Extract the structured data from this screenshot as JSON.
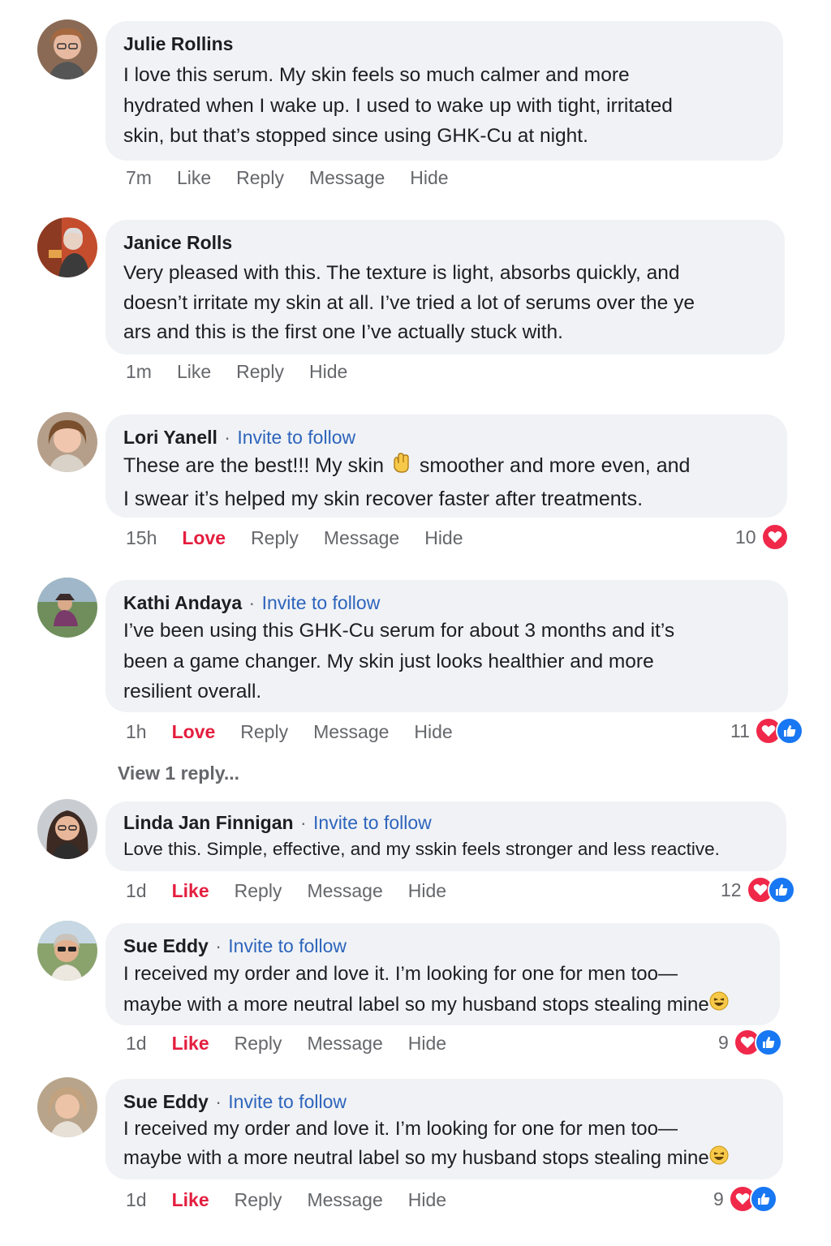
{
  "comments": [
    {
      "name": "Julie Rollins",
      "follow": "",
      "lines": [
        "I love this serum. My skin feels so much calmer and more",
        "hydrated when I wake up. I used to wake up with tight, irritated",
        "skin, but that’s stopped since using GHK-Cu at night."
      ],
      "time": "7m",
      "like": "Like",
      "reply": "Reply",
      "message": "Message",
      "hide": "Hide",
      "count": ""
    },
    {
      "name": "Janice Rolls",
      "follow": "",
      "lines": [
        "Very pleased with this. The texture is light, absorbs quickly, and",
        "doesn’t irritate my skin at all. I’ve tried a lot of serums over the ye",
        "ars and this is the first one I’ve actually stuck with."
      ],
      "time": "1m",
      "like": "Like",
      "reply": "Reply",
      "message": "",
      "hide": "Hide",
      "count": ""
    },
    {
      "name": "Lori Yanell",
      "follow": "Invite to follow",
      "line1a": "These are the best!!!  My skin ",
      "line1b": " smoother and more even, and",
      "line2": "I swear it’s helped my skin recover faster after treatments.",
      "time": "15h",
      "like": "Love",
      "reply": "Reply",
      "message": "Message",
      "hide": "Hide",
      "count": "10"
    },
    {
      "name": "Kathi Andaya",
      "follow": "Invite to follow",
      "lines": [
        "I’ve been using this GHK-Cu serum for about 3 months and it’s",
        "been a game changer. My skin just looks healthier and more",
        "resilient overall."
      ],
      "time": "1h",
      "like": "Love",
      "reply": "Reply",
      "message": "Message",
      "hide": "Hide",
      "count": "11"
    },
    {
      "name": "Linda Jan Finnigan",
      "follow": "Invite to follow",
      "lines": [
        "Love this. Simple, effective, and my sskin feels stronger and less reactive."
      ],
      "time": "1d",
      "like": "Like",
      "reply": "Reply",
      "message": "Message",
      "hide": "Hide",
      "count": "12"
    },
    {
      "name": "Sue Eddy",
      "follow": "Invite to follow",
      "lines": [
        "I received my order and love it. I’m looking for one for men too—",
        "maybe with a more neutral label so my husband stops stealing mine"
      ],
      "time": "1d",
      "like": "Like",
      "reply": "Reply",
      "message": "Message",
      "hide": "Hide",
      "count": "9"
    },
    {
      "name": "Sue Eddy",
      "follow": "Invite to follow",
      "lines": [
        "I received my order and love it. I’m looking for one for men too—",
        "maybe with a more neutral label so my husband stops stealing mine"
      ],
      "time": "1d",
      "like": "Like",
      "reply": "Reply",
      "message": "Message",
      "hide": "Hide",
      "count": "9"
    }
  ],
  "view_replies": "View 1 reply...",
  "separator": "·",
  "icons": {
    "heart": "heart-reaction-icon",
    "like": "thumbs-up-reaction-icon",
    "laugh": "laughing-emoji-icon",
    "hand": "hand-emoji-icon"
  },
  "colors": {
    "bubble": "#f0f2f5",
    "link": "#2d64bc",
    "love": "#e41e3f",
    "meta": "#65676b"
  }
}
